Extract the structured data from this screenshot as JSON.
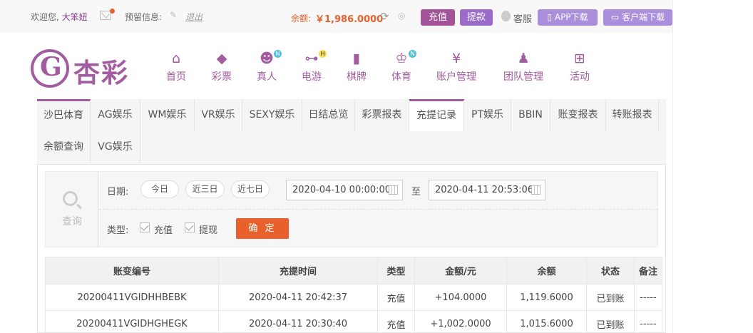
{
  "topbar": {
    "welcome": "欢迎您,",
    "username": "大笨妞",
    "reserved_info": "预留信息:",
    "logout": "退出",
    "balance_label": "余额:",
    "balance_value": "￥1,986.0000",
    "recharge": "充值",
    "withdraw": "提款",
    "service": "客服",
    "app_download": "APP下载",
    "client_download": "客户端下载"
  },
  "logo": {
    "text": "杏彩"
  },
  "nav": [
    {
      "label": "首页",
      "icon": "home-icon",
      "badge": ""
    },
    {
      "label": "彩票",
      "icon": "lottery-ticket-icon",
      "badge": ""
    },
    {
      "label": "真人",
      "icon": "live-dealer-icon",
      "badge": "N"
    },
    {
      "label": "电游",
      "icon": "gamepad-icon",
      "badge": "H"
    },
    {
      "label": "棋牌",
      "icon": "cards-icon",
      "badge": ""
    },
    {
      "label": "体育",
      "icon": "trophy-icon",
      "badge": "N"
    },
    {
      "label": "账户管理",
      "icon": "yen-coin-icon",
      "badge": ""
    },
    {
      "label": "团队管理",
      "icon": "team-icon",
      "badge": ""
    },
    {
      "label": "活动",
      "icon": "gift-icon",
      "badge": ""
    }
  ],
  "tabs": [
    "沙巴体育",
    "AG娱乐",
    "WM娱乐",
    "VR娱乐",
    "SEXY娱乐",
    "日结总览",
    "彩票报表",
    "充提记录",
    "PT娱乐",
    "BBIN",
    "账变报表",
    "转账报表",
    "余额查询",
    "VG娱乐"
  ],
  "filter": {
    "query_label": "查询",
    "date_label": "日期:",
    "today": "今日",
    "three_days": "近三日",
    "seven_days": "近七日",
    "start": "2020-04-10 00:00:00",
    "to": "至",
    "end": "2020-04-11 20:53:06",
    "type_label": "类型:",
    "type_recharge": "充值",
    "type_withdraw": "提现",
    "confirm": "确 定"
  },
  "table": {
    "headers": [
      "账变编号",
      "充提时间",
      "类型",
      "金额/元",
      "余额",
      "状态",
      "备注"
    ],
    "rows": [
      [
        "20200411VGIDHHBEBK",
        "2020-04-11 20:42:37",
        "充值",
        "+104.0000",
        "1,119.6000",
        "已到账",
        "-----"
      ],
      [
        "20200411VGIDHGHEGK",
        "2020-04-11 20:30:40",
        "充值",
        "+1,002.0000",
        "1,015.6000",
        "已到账",
        "-----"
      ]
    ]
  },
  "colors": {
    "brand": "#a35c9f",
    "accent": "#e8612c",
    "success": "#2fa33c",
    "amount": "#e23b3b"
  }
}
